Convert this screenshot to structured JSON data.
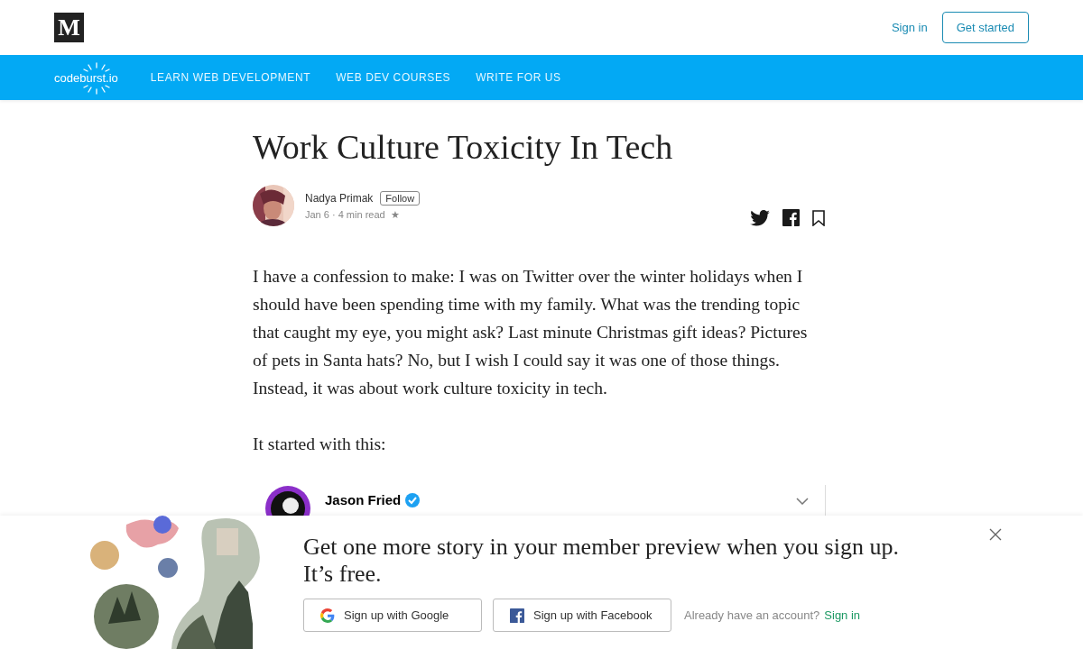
{
  "header": {
    "logo": "M",
    "sign_in": "Sign in",
    "get_started": "Get started"
  },
  "nav": {
    "brand": "codeburst.io",
    "links": [
      "LEARN WEB DEVELOPMENT",
      "WEB DEV COURSES",
      "WRITE FOR US"
    ]
  },
  "article": {
    "title": "Work Culture Toxicity In Tech",
    "author": {
      "name": "Nadya Primak",
      "follow": "Follow",
      "meta": "Jan 6 · 4 min read",
      "star": "★"
    },
    "paragraphs": [
      "I have a confession to make: I was on Twitter over the winter holidays when I should have been spending time with my family. What was the trending topic that caught my eye, you might ask? Last minute Christmas gift ideas? Pictures of pets in Santa hats? No, but I wish I could say it was one of those things. Instead, it was about work culture toxicity in tech.",
      "It started with this:"
    ],
    "tweet": {
      "name": "Jason Fried"
    }
  },
  "signup_banner": {
    "heading": "Get one more story in your member preview when you sign up. It’s free.",
    "google": "Sign up with Google",
    "facebook": "Sign up with Facebook",
    "account_prompt": "Already have an account?",
    "sign_in": "Sign in"
  }
}
